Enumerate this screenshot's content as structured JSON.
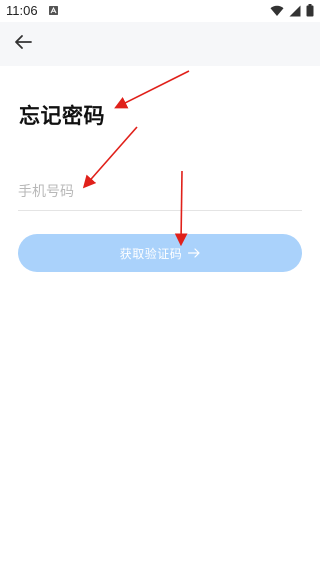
{
  "status_bar": {
    "time": "11:06",
    "notification_icon": "a-app-icon",
    "icons": [
      "wifi-icon",
      "signal-icon",
      "battery-icon"
    ]
  },
  "header": {
    "back_icon": "arrow-left-icon"
  },
  "main": {
    "title": "忘记密码",
    "phone": {
      "value": "",
      "placeholder": "手机号码"
    },
    "get_code_button": {
      "label": "获取验证码",
      "icon": "arrow-right-icon"
    }
  },
  "colors": {
    "header_bg": "#f6f7f9",
    "button_bg": "#aad2fb",
    "annotation_arrow": "#e0201a"
  }
}
